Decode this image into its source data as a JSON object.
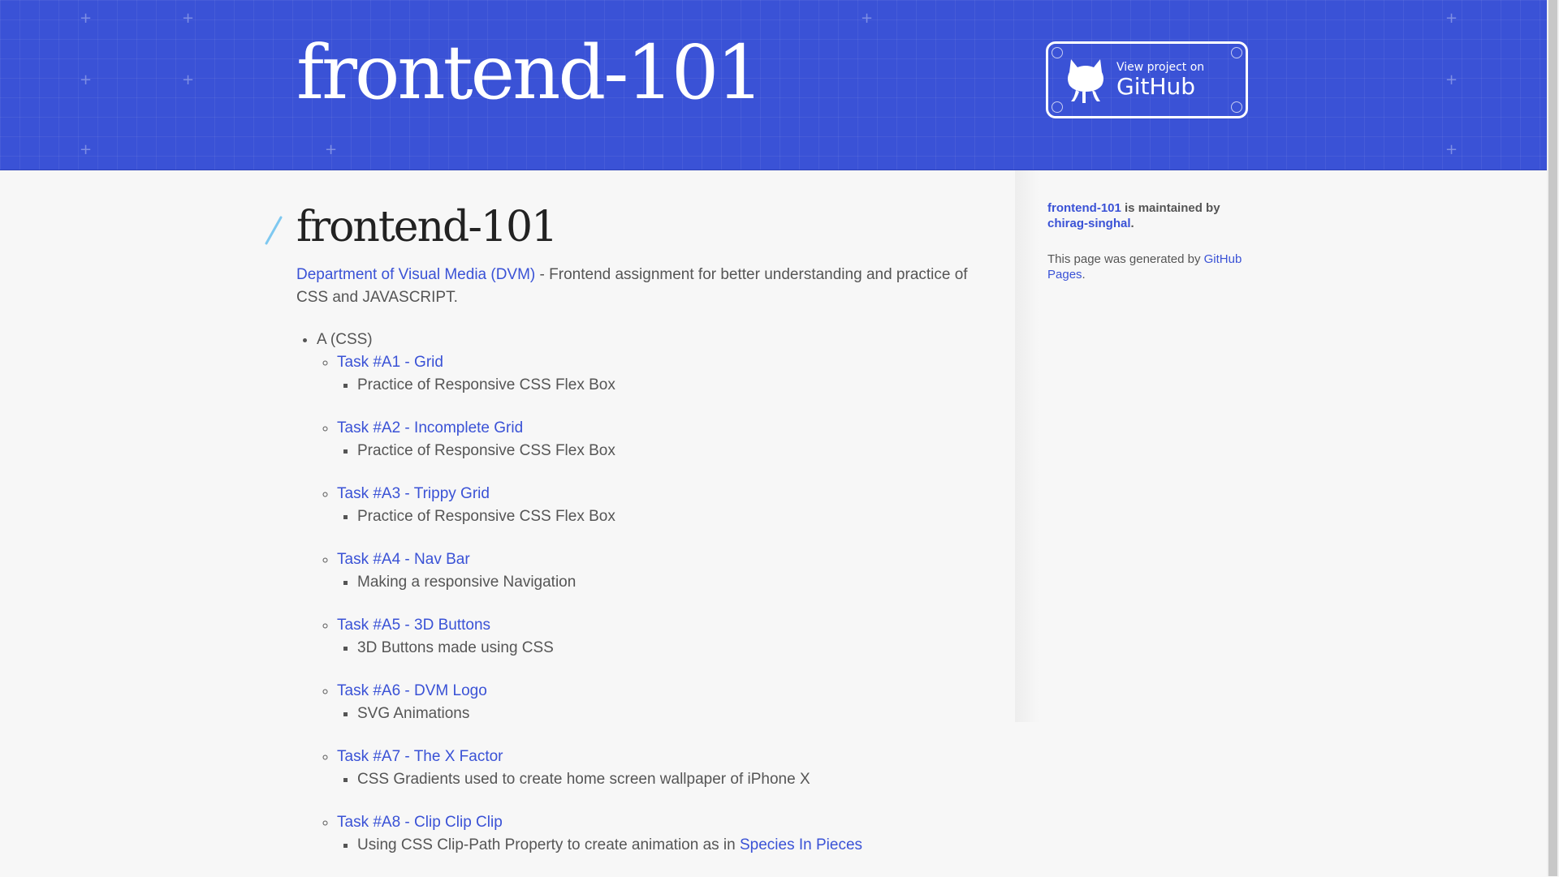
{
  "header": {
    "site_title": "frontend-101",
    "github_button": {
      "small": "View project on",
      "big": "GitHub"
    }
  },
  "main": {
    "title": "frontend-101",
    "intro": {
      "link": "Department of Visual Media (DVM)",
      "text": " - Frontend assignment for better understanding and practice of CSS and JAVASCRIPT."
    },
    "section_label": "A (CSS)",
    "tasks": [
      {
        "link": "Task #A1 - Grid",
        "desc": "Practice of Responsive CSS Flex Box"
      },
      {
        "link": "Task #A2 - Incomplete Grid",
        "desc": "Practice of Responsive CSS Flex Box"
      },
      {
        "link": "Task #A3 - Trippy Grid",
        "desc": "Practice of Responsive CSS Flex Box"
      },
      {
        "link": "Task #A4 - Nav Bar",
        "desc": "Making a responsive Navigation"
      },
      {
        "link": "Task #A5 - 3D Buttons",
        "desc": "3D Buttons made using CSS"
      },
      {
        "link": "Task #A6 - DVM Logo",
        "desc": "SVG Animations"
      },
      {
        "link": "Task #A7 - The X Factor",
        "desc": "CSS Gradients used to create home screen wallpaper of iPhone X"
      },
      {
        "link": "Task #A8 - Clip Clip Clip",
        "desc": "Using CSS Clip-Path Property to create animation as in ",
        "desc_link": "Species In Pieces"
      }
    ]
  },
  "sidebar": {
    "maintained": {
      "project_link": "frontend-101",
      "text": " is maintained by ",
      "user_link": "chirag-singhal",
      "end": "."
    },
    "generated": {
      "text": "This page was generated by ",
      "link": "GitHub Pages",
      "end": "."
    }
  },
  "colors": {
    "header_bg": "#3a52d6",
    "link": "#3a52d6",
    "text": "#555555",
    "page_bg": "#f7f7f7"
  }
}
